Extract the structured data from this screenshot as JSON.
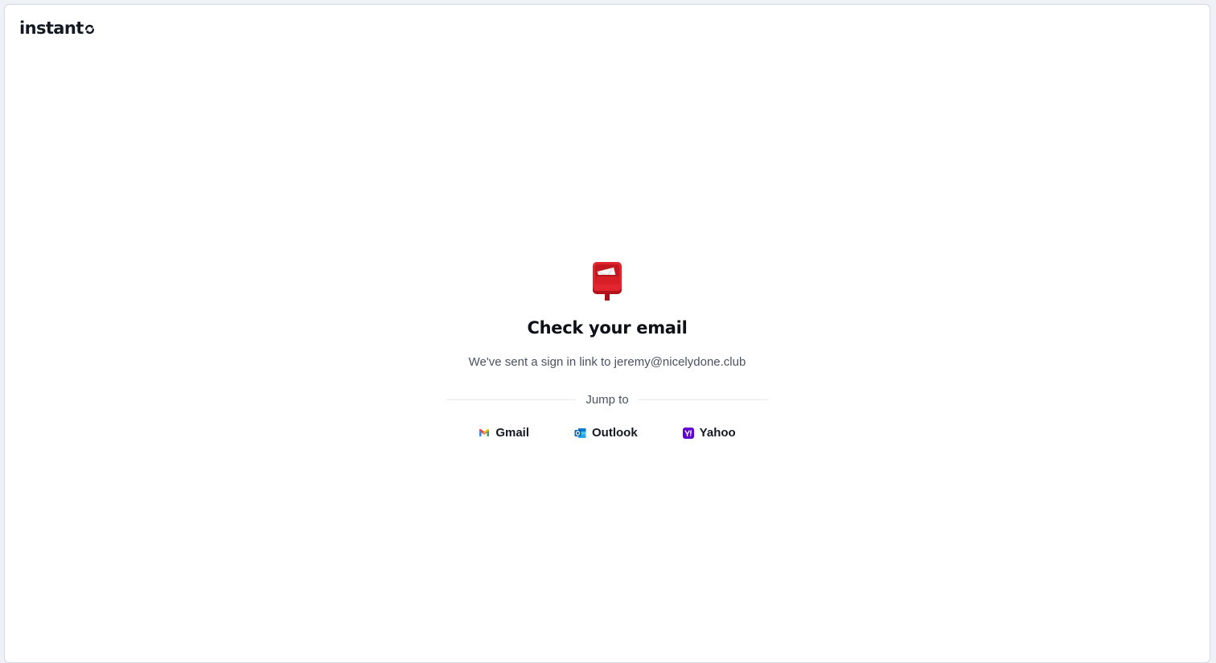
{
  "brand": {
    "name": "instant",
    "icon": "instant-logo-icon"
  },
  "main": {
    "icon": "postbox-icon",
    "title": "Check your email",
    "message": "We've sent a sign in link to jeremy@nicelydone.club",
    "divider_label": "Jump to",
    "providers": [
      {
        "label": "Gmail",
        "icon": "gmail-icon"
      },
      {
        "label": "Outlook",
        "icon": "outlook-icon"
      },
      {
        "label": "Yahoo",
        "icon": "yahoo-icon"
      }
    ]
  },
  "colors": {
    "title": "#0d1117",
    "muted_text": "#4a5261",
    "mailbox_red": "#d11c25",
    "yahoo_purple": "#6001d2",
    "outlook_blue": "#0a64ad"
  }
}
